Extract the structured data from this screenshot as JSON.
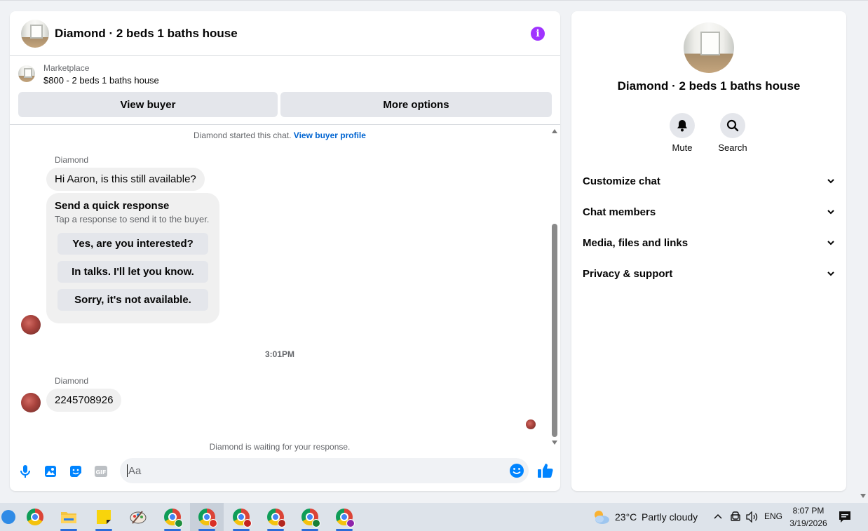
{
  "conversation": {
    "title": "Diamond · 2 beds 1 baths house",
    "listing": {
      "source": "Marketplace",
      "price_title": "$800 - 2 beds 1 baths house"
    },
    "actions": {
      "view_buyer": "View buyer",
      "more_options": "More options"
    },
    "started_note": "Diamond started this chat.",
    "view_profile_link": "View buyer profile",
    "messages": [
      {
        "sender": "Diamond",
        "text": "Hi Aaron, is this still available?"
      },
      {
        "sender": "Diamond",
        "text": "2245708926"
      }
    ],
    "quick_response": {
      "title": "Send a quick response",
      "subtitle": "Tap a response to send it to the buyer.",
      "options": [
        "Yes, are you interested?",
        "In talks. I'll let you know.",
        "Sorry, it's not available."
      ]
    },
    "time_separator": "3:01PM",
    "waiting_note": "Diamond is waiting for your response.",
    "composer": {
      "placeholder": "Aa"
    },
    "accent_color": "#0084ff",
    "info_icon_color": "#a033ff"
  },
  "info_panel": {
    "name": "Diamond · 2 beds 1 baths house",
    "actions": [
      {
        "label": "Mute",
        "icon": "bell-icon"
      },
      {
        "label": "Search",
        "icon": "search-icon"
      }
    ],
    "sections": [
      "Customize chat",
      "Chat members",
      "Media, files and links",
      "Privacy & support"
    ]
  },
  "taskbar": {
    "apps": [
      "chrome",
      "file-explorer",
      "sticky-notes",
      "paint",
      "chrome-profile-1",
      "chrome-profile-2",
      "chrome-profile-3",
      "chrome-profile-4",
      "chrome-profile-5",
      "chrome-profile-6"
    ],
    "weather": {
      "temp": "23°C",
      "condition": "Partly cloudy"
    },
    "language": "ENG",
    "time": "8:07 PM",
    "date": "3/19/2026"
  }
}
